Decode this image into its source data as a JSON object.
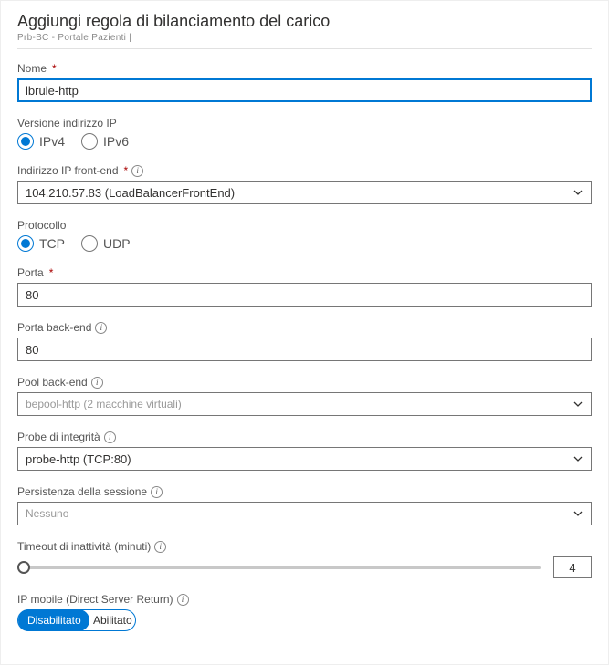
{
  "header": {
    "title": "Aggiungi regola di bilanciamento del carico",
    "breadcrumb": "Prb-BC - Portale Pazienti  |"
  },
  "fields": {
    "name": {
      "label": "Nome",
      "value": "lbrule-http"
    },
    "ipver": {
      "label": "Versione indirizzo IP",
      "opt_ipv4": "IPv4",
      "opt_ipv6": "IPv6",
      "selected": "ipv4"
    },
    "frontend": {
      "label": "Indirizzo IP front-end",
      "value": "104.210.57.83 (LoadBalancerFrontEnd)"
    },
    "protocol": {
      "label": "Protocollo",
      "opt_tcp": "TCP",
      "opt_udp": "UDP",
      "selected": "tcp"
    },
    "port": {
      "label": "Porta",
      "value": "80"
    },
    "backend_port": {
      "label": "Porta back-end",
      "value": "80"
    },
    "backend_pool": {
      "label": "Pool back-end",
      "value": "bepool-http (2 macchine virtuali)"
    },
    "probe": {
      "label": "Probe di integrità",
      "value": "probe-http (TCP:80)"
    },
    "persistence": {
      "label": "Persistenza della sessione",
      "value": "Nessuno"
    },
    "timeout": {
      "label": "Timeout di inattività (minuti)",
      "value": "4"
    },
    "floating": {
      "label": "IP mobile (Direct Server Return)",
      "off": "Disabilitato",
      "on": "Abilitato"
    }
  }
}
